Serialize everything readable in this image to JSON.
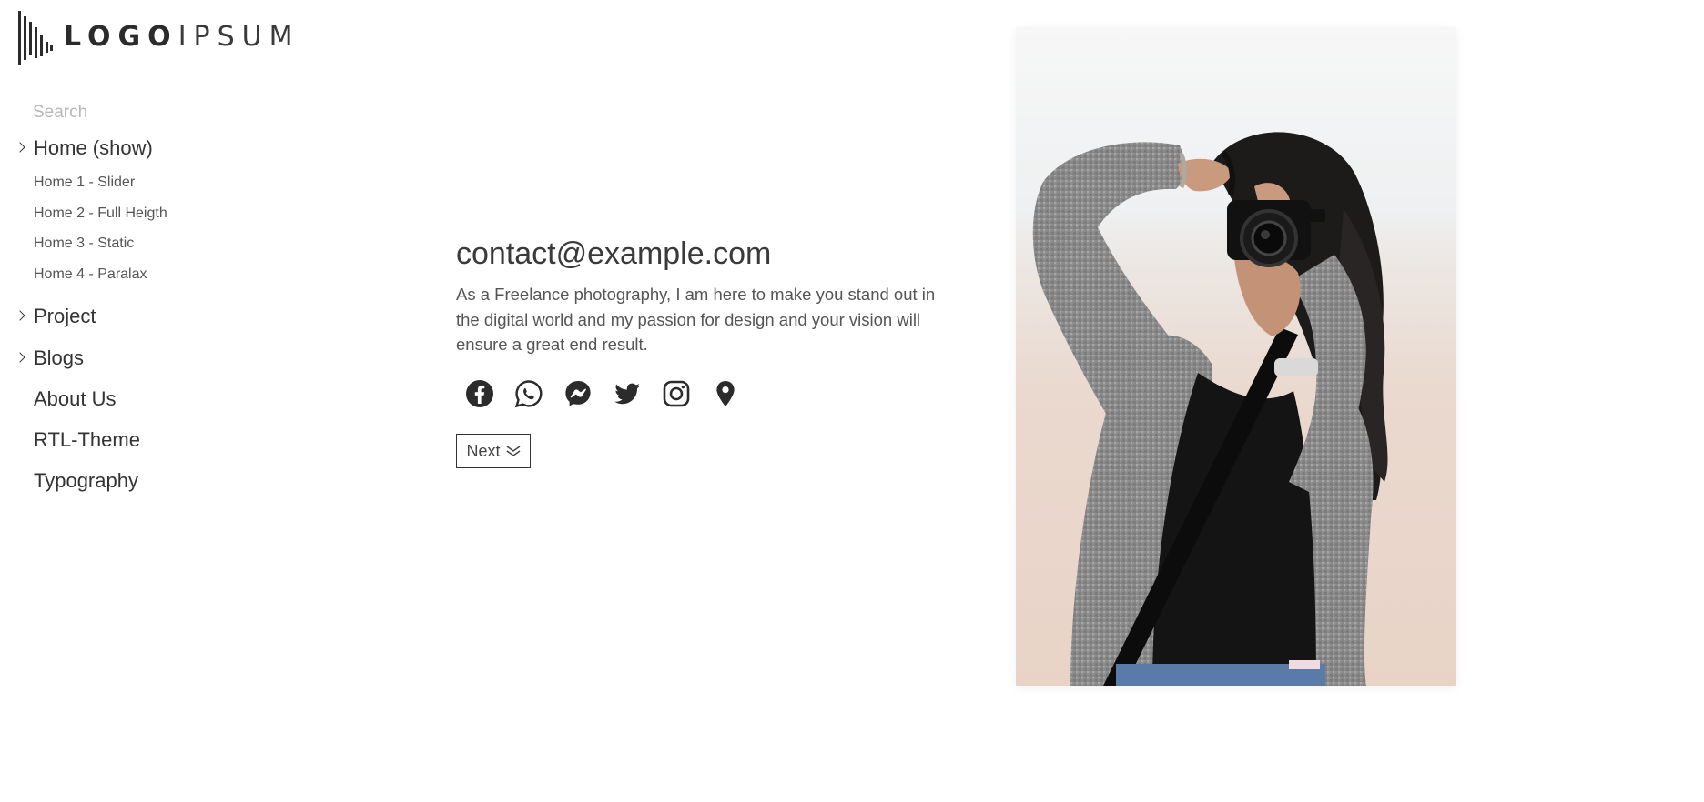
{
  "brand": {
    "logo_primary": "LOGO",
    "logo_secondary": "IPSUM"
  },
  "search": {
    "placeholder": "Search",
    "value": ""
  },
  "nav": {
    "home": "Home (show)",
    "home_items": [
      "Home 1 - Slider",
      "Home 2 - Full Heigth",
      "Home 3 - Static",
      "Home 4 - Paralax"
    ],
    "project": "Project",
    "blogs": "Blogs",
    "about": "About Us",
    "rtl": "RTL-Theme",
    "typography": "Typography"
  },
  "content": {
    "email": "contact@example.com",
    "description": "As a Freelance photography, I am here to make you stand out in the digital world and my passion for design and your vision will ensure a great end result.",
    "next_label": "Next"
  },
  "socials": [
    "facebook-icon",
    "whatsapp-icon",
    "messenger-icon",
    "twitter-icon",
    "instagram-icon",
    "location-pin-icon"
  ],
  "colors": {
    "text": "#2b2b2b",
    "muted": "#555555",
    "placeholder": "#b7b7b7",
    "border": "#333333"
  }
}
